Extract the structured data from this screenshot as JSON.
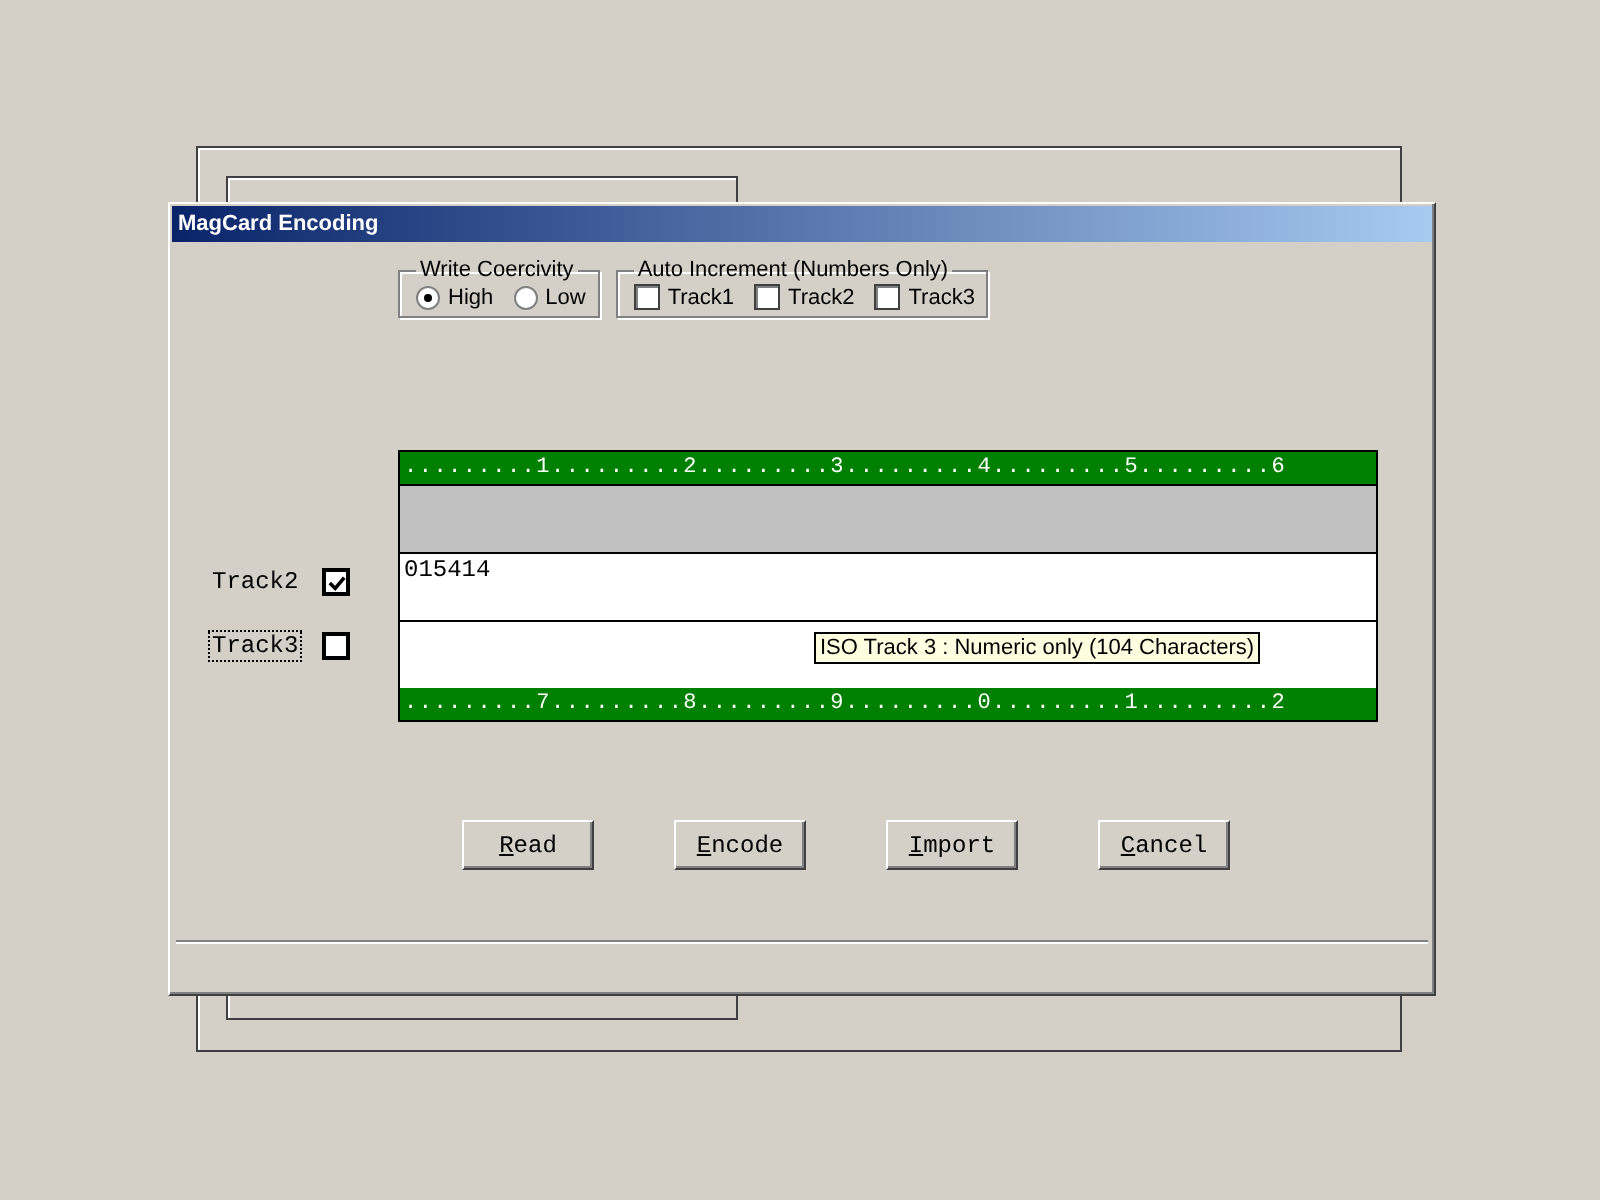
{
  "window": {
    "title": "MagCard Encoding"
  },
  "write_coercivity": {
    "title": "Write Coercivity",
    "options": [
      {
        "label": "High",
        "selected": true
      },
      {
        "label": "Low",
        "selected": false
      }
    ]
  },
  "auto_increment": {
    "title": "Auto Increment (Numbers Only)",
    "options": [
      {
        "label": "Track1",
        "checked": false
      },
      {
        "label": "Track2",
        "checked": false
      },
      {
        "label": "Track3",
        "checked": false
      }
    ]
  },
  "ruler_top": ".........1.........2.........3.........4.........5.........6",
  "tracks": [
    {
      "disabled": true
    },
    {
      "label": "Track2",
      "checked": true,
      "focused": false,
      "value": "015414",
      "disabled": false
    },
    {
      "label": "Track3",
      "checked": false,
      "focused": true,
      "disabled": false
    }
  ],
  "ruler_bottom": ".........7.........8.........9.........0.........1.........2",
  "tooltip": "ISO Track 3 : Numeric only (104 Characters)",
  "buttons": [
    {
      "mnemonic": "R",
      "rest": "ead"
    },
    {
      "mnemonic": "E",
      "rest": "ncode"
    },
    {
      "mnemonic": "I",
      "rest": "mport"
    },
    {
      "mnemonic": "C",
      "rest": "ancel"
    }
  ]
}
